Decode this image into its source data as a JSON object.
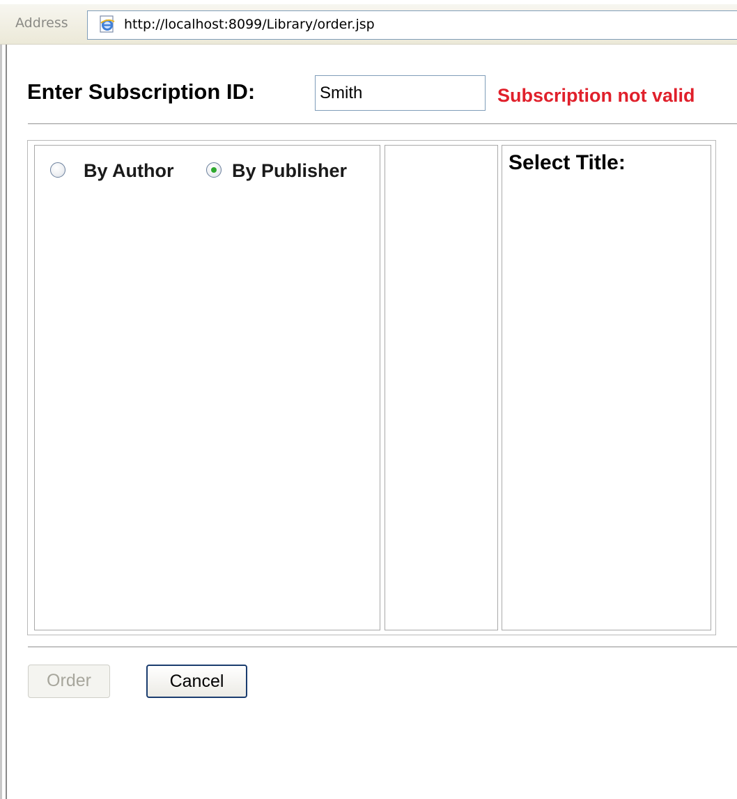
{
  "browser": {
    "address_label": "Address",
    "url": "http://localhost:8099/Library/order.jsp"
  },
  "form": {
    "subscription_label": "Enter Subscription ID:",
    "subscription_value": "Smith",
    "error_message": "Subscription not valid",
    "error_color": "#e0202b",
    "search_options": [
      {
        "label": "By Author",
        "selected": false
      },
      {
        "label": "By Publisher",
        "selected": true
      }
    ],
    "select_title_label": "Select Title:",
    "order_button": "Order",
    "order_button_enabled": false,
    "cancel_button": "Cancel"
  },
  "icons": {
    "address_icon": "ie-page-icon"
  }
}
